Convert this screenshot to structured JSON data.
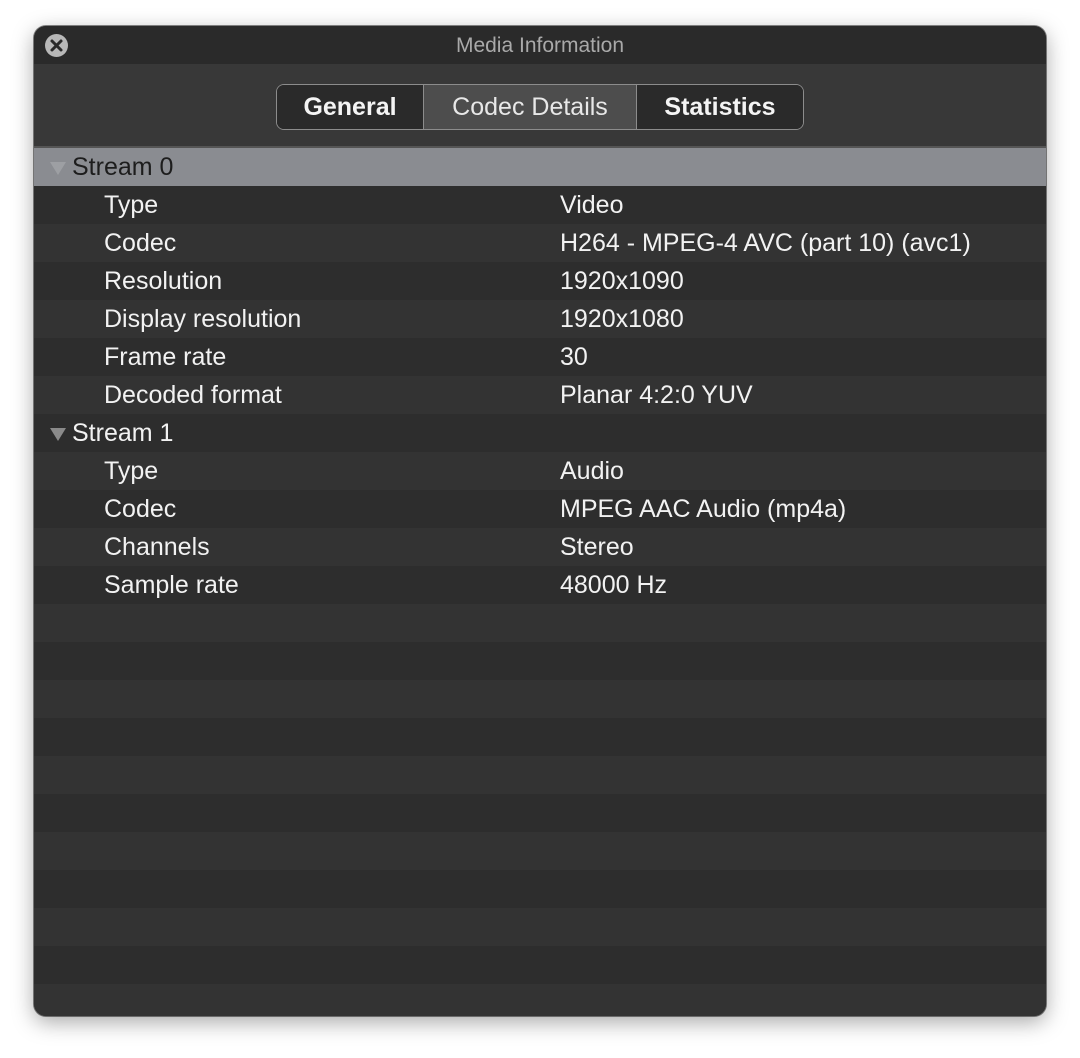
{
  "window": {
    "title": "Media Information"
  },
  "tabs": [
    {
      "label": "General"
    },
    {
      "label": "Codec Details"
    },
    {
      "label": "Statistics"
    }
  ],
  "active_tab": "Codec Details",
  "streams": [
    {
      "label": "Stream 0",
      "expanded": true,
      "properties": [
        {
          "key": "Type",
          "value": "Video"
        },
        {
          "key": "Codec",
          "value": "H264 - MPEG-4 AVC (part 10) (avc1)"
        },
        {
          "key": "Resolution",
          "value": "1920x1090"
        },
        {
          "key": "Display resolution",
          "value": "1920x1080"
        },
        {
          "key": "Frame rate",
          "value": "30"
        },
        {
          "key": "Decoded format",
          "value": "Planar 4:2:0 YUV"
        }
      ]
    },
    {
      "label": "Stream 1",
      "expanded": true,
      "properties": [
        {
          "key": "Type",
          "value": "Audio"
        },
        {
          "key": "Codec",
          "value": "MPEG AAC Audio (mp4a)"
        },
        {
          "key": "Channels",
          "value": "Stereo"
        },
        {
          "key": "Sample rate",
          "value": "48000 Hz"
        }
      ]
    }
  ],
  "icons": {
    "close": "close-icon",
    "disclosure": "disclosure-triangle-down-icon"
  },
  "colors": {
    "selection": "#8a8c91",
    "background": "#2c2c2c"
  }
}
